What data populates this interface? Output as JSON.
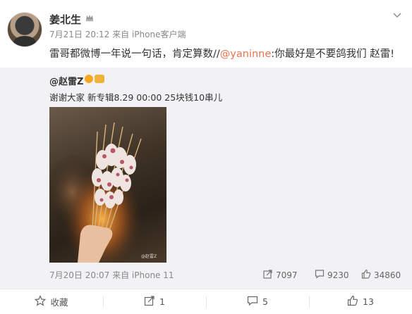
{
  "post": {
    "author": "姜北生",
    "date": "7月21日 20:12",
    "source": "来自 iPhone客户端",
    "text_main": "雷哥都微博一年说一句话，肯定算数//",
    "mention": "@yaninne",
    "text_rest": ":你最好是不要鸽我们 赵雷!"
  },
  "repost": {
    "author": "@赵雷Z",
    "text": "谢谢大家 新专辑8.29 00:00 25块钱10串儿",
    "photo_watermark": "@赵雷Z",
    "time": "7月20日 20:07 来自 iPhone 11",
    "reposts": "7097",
    "comments": "9230",
    "likes": "34860"
  },
  "actions": {
    "favorite": "收藏",
    "repost": "1",
    "comment": "5",
    "like": "13"
  }
}
